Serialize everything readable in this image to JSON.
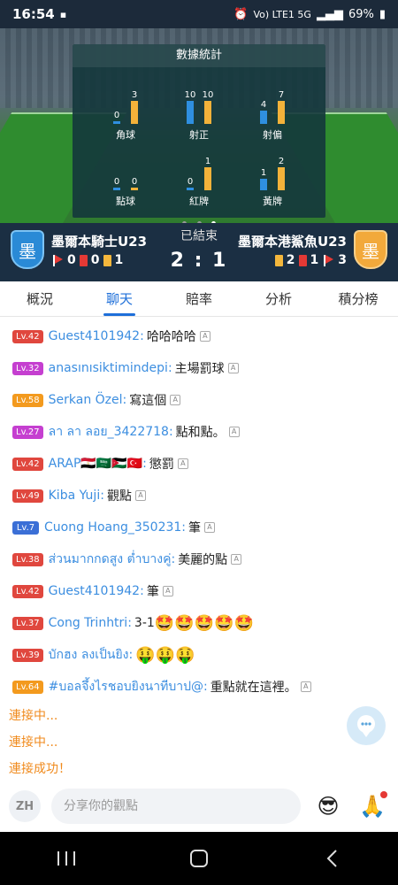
{
  "status_bar": {
    "time": "16:54",
    "network": "Vo) LTE1 5G",
    "battery": "69%"
  },
  "stats_panel": {
    "title": "數據統計",
    "stats": [
      {
        "label": "角球",
        "home": 0,
        "away": 3
      },
      {
        "label": "射正",
        "home": 10,
        "away": 10
      },
      {
        "label": "射偏",
        "home": 4,
        "away": 7
      },
      {
        "label": "點球",
        "home": 0,
        "away": 0
      },
      {
        "label": "紅牌",
        "home": 0,
        "away": 1
      },
      {
        "label": "黃牌",
        "home": 1,
        "away": 2
      }
    ]
  },
  "match": {
    "home": {
      "name": "墨爾本騎士U23",
      "badge": "墨",
      "corners": 0,
      "red_cards": 0,
      "yellow_cards": 1
    },
    "away": {
      "name": "墨爾本港鯊魚U23",
      "badge": "墨",
      "yellow_cards": 2,
      "red_cards": 1,
      "corners": 3
    },
    "status": "已結束",
    "score": "2 : 1"
  },
  "tabs": [
    {
      "label": "概況",
      "active": false
    },
    {
      "label": "聊天",
      "active": true
    },
    {
      "label": "賠率",
      "active": false
    },
    {
      "label": "分析",
      "active": false
    },
    {
      "label": "積分榜",
      "active": false
    }
  ],
  "chat": {
    "messages": [
      {
        "level": "Lv.42",
        "level_color": "#e0473e",
        "user": "Guest4101942:",
        "text": "哈哈哈哈"
      },
      {
        "level": "Lv.32",
        "level_color": "#c53fd0",
        "user": "anasınısiktimindepi:",
        "text": "主場罰球"
      },
      {
        "level": "Lv.58",
        "level_color": "#f39a1e",
        "user": "Serkan Özel:",
        "text": "寫這個"
      },
      {
        "level": "Lv.27",
        "level_color": "#c53fd0",
        "user": "ลา ลา ลอย_3422718:",
        "text": "點和點。"
      },
      {
        "level": "Lv.42",
        "level_color": "#e0473e",
        "user": "ARAP🇪🇬🇸🇦🇯🇴🇹🇷:",
        "text": "懲罰"
      },
      {
        "level": "Lv.49",
        "level_color": "#e0473e",
        "user": "Kiba Yuji:",
        "text": "觀點"
      },
      {
        "level": "Lv.7",
        "level_color": "#3b6fd6",
        "user": "Cuong Hoang_350231:",
        "text": "筆"
      },
      {
        "level": "Lv.38",
        "level_color": "#e0473e",
        "user": "ส่วนมากกดสูง ต่ำบางคู่:",
        "text": "美麗的點"
      },
      {
        "level": "Lv.42",
        "level_color": "#e0473e",
        "user": "Guest4101942:",
        "text": "筆"
      },
      {
        "level": "Lv.37",
        "level_color": "#e0473e",
        "user": "Cong Trinhtri:",
        "text": "3-1",
        "emojis": "🤩🤩🤩🤩🤩"
      },
      {
        "level": "Lv.39",
        "level_color": "#e0473e",
        "user": "บักฮง ลงเป็นยิง:",
        "text": "",
        "emojis": "🤑🤑🤑"
      },
      {
        "level": "Lv.64",
        "level_color": "#f39a1e",
        "user": "#บอลจึ้งไรชอบยิงนาทีบาป@:",
        "text": "重點就在這裡。"
      }
    ],
    "system": [
      "連接中...",
      "連接中...",
      "連接成功！"
    ]
  },
  "input": {
    "lang": "ZH",
    "placeholder": "分享你的觀點"
  },
  "icons": {
    "float": "chat-bubble-icon",
    "emoji": "sunglasses-face-icon",
    "gift": "pray-hands-icon"
  }
}
